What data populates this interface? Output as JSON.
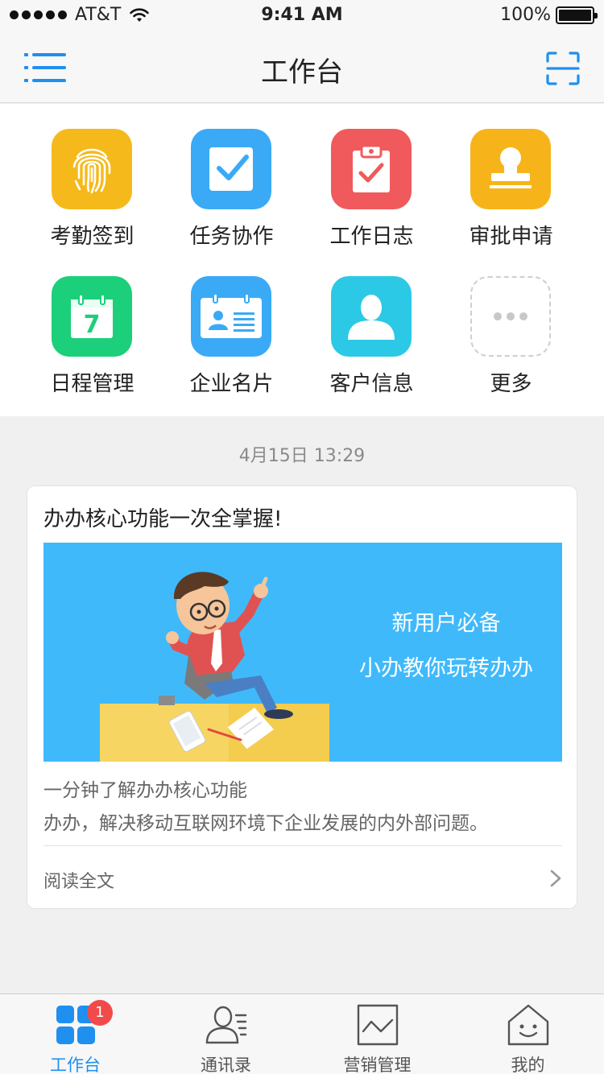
{
  "status_bar": {
    "carrier": "AT&T",
    "time": "9:41 AM",
    "battery": "100%"
  },
  "nav": {
    "title": "工作台"
  },
  "grid": {
    "items": [
      {
        "label": "考勤签到",
        "icon": "fingerprint-icon",
        "color": "#f5b91b"
      },
      {
        "label": "任务协作",
        "icon": "checkbox-icon",
        "color": "#3aaaf6"
      },
      {
        "label": "工作日志",
        "icon": "clipboard-icon",
        "color": "#f05a5c"
      },
      {
        "label": "审批申请",
        "icon": "stamp-icon",
        "color": "#f7b41a"
      },
      {
        "label": "日程管理",
        "icon": "calendar-icon",
        "color": "#1ccf7a"
      },
      {
        "label": "企业名片",
        "icon": "id-card-icon",
        "color": "#3aaaf6"
      },
      {
        "label": "客户信息",
        "icon": "customer-icon",
        "color": "#2cc9e6"
      },
      {
        "label": "更多",
        "icon": "more-icon",
        "color": "#ffffff"
      }
    ],
    "calendar_day": "7"
  },
  "feed": {
    "timestamp": "4月15日 13:29",
    "card": {
      "title": "办办核心功能一次全掌握!",
      "banner_line1": "新用户必备",
      "banner_line2": "小办教你玩转办办",
      "subtitle": "一分钟了解办办核心功能",
      "description": "办办，解决移动互联网环境下企业发展的内外部问题。",
      "read_more": "阅读全文"
    }
  },
  "tabs": [
    {
      "label": "工作台",
      "icon": "workbench-icon",
      "active": true,
      "badge": "1"
    },
    {
      "label": "通讯录",
      "icon": "contacts-icon",
      "active": false
    },
    {
      "label": "营销管理",
      "icon": "marketing-chart-icon",
      "active": false
    },
    {
      "label": "我的",
      "icon": "home-face-icon",
      "active": false
    }
  ],
  "colors": {
    "accent": "#1f8ff0",
    "badge": "#f24a4a",
    "banner": "#40b9fb"
  }
}
